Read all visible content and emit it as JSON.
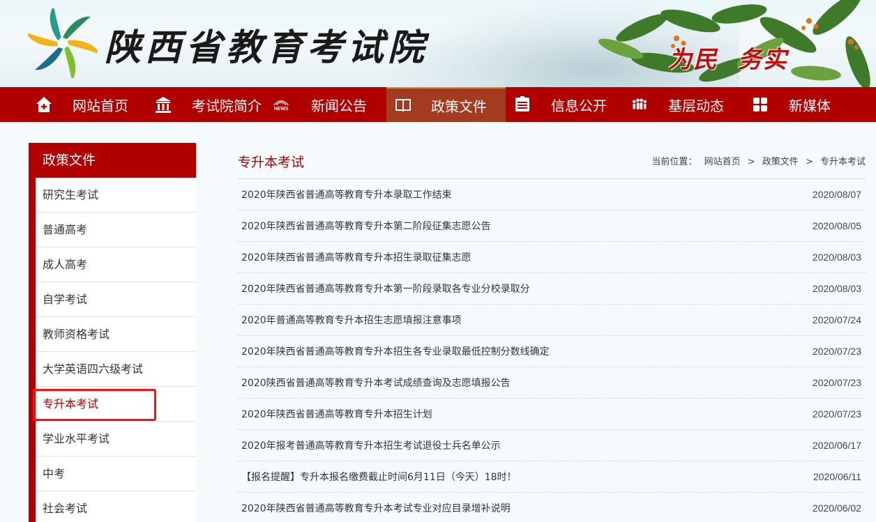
{
  "header": {
    "site_title": "陕西省教育考试院",
    "slogan": "为民 务实"
  },
  "nav": {
    "items": [
      {
        "label": "网站首页",
        "icon": "home-plus-icon"
      },
      {
        "label": "考试院简介",
        "icon": "building-icon"
      },
      {
        "label": "新闻公告",
        "icon": "news-icon",
        "icon_text": "NEWS"
      },
      {
        "label": "政策文件",
        "icon": "book-icon",
        "active": true
      },
      {
        "label": "信息公开",
        "icon": "document-icon"
      },
      {
        "label": "基层动态",
        "icon": "people-icon"
      },
      {
        "label": "新媒体",
        "icon": "grid-icon"
      }
    ]
  },
  "sidebar": {
    "title": "政策文件",
    "items": [
      {
        "label": "研究生考试"
      },
      {
        "label": "普通高考"
      },
      {
        "label": "成人高考"
      },
      {
        "label": "自学考试"
      },
      {
        "label": "教师资格考试"
      },
      {
        "label": "大学英语四六级考试"
      },
      {
        "label": "专升本考试",
        "current": true
      },
      {
        "label": "学业水平考试"
      },
      {
        "label": "中考"
      },
      {
        "label": "社会考试"
      }
    ]
  },
  "main": {
    "title": "专升本考试",
    "breadcrumb": {
      "prefix": "当前位置：",
      "items": [
        "网站首页",
        "政策文件",
        "专升本考试"
      ],
      "separator": ">"
    },
    "articles": [
      {
        "title": "2020年陕西省普通高等教育专升本录取工作结束",
        "date": "2020/08/07"
      },
      {
        "title": "2020年陕西省普通高等教育专升本第二阶段征集志愿公告",
        "date": "2020/08/05"
      },
      {
        "title": "2020年陕西省普通高等教育专升本招生录取征集志愿",
        "date": "2020/08/03"
      },
      {
        "title": "2020年陕西省普通高等教育专升本第一阶段录取各专业分校录取分",
        "date": "2020/08/03"
      },
      {
        "title": "2020年普通高等教育专升本招生志愿填报注意事项",
        "date": "2020/07/24"
      },
      {
        "title": "2020年陕西省普通高等教育专升本招生各专业录取最低控制分数线确定",
        "date": "2020/07/23"
      },
      {
        "title": "2020陕西省普通高等教育专升本考试成绩查询及志愿填报公告",
        "date": "2020/07/23"
      },
      {
        "title": "2020年陕西省普通高等教育专升本招生计划",
        "date": "2020/07/23"
      },
      {
        "title": "2020年报考普通高等教育专升本招生考试退役士兵名单公示",
        "date": "2020/06/17"
      },
      {
        "title": "【报名提醒】专升本报名缴费截止时间6月11日（今天）18时！",
        "date": "2020/06/11"
      },
      {
        "title": "2020年陕西省普通高等教育专升本考试专业对应目录增补说明",
        "date": "2020/06/02"
      }
    ]
  },
  "colors": {
    "brand_red": "#b10000",
    "active_nav": "#a43a20",
    "highlight_box": "#ff1010"
  }
}
